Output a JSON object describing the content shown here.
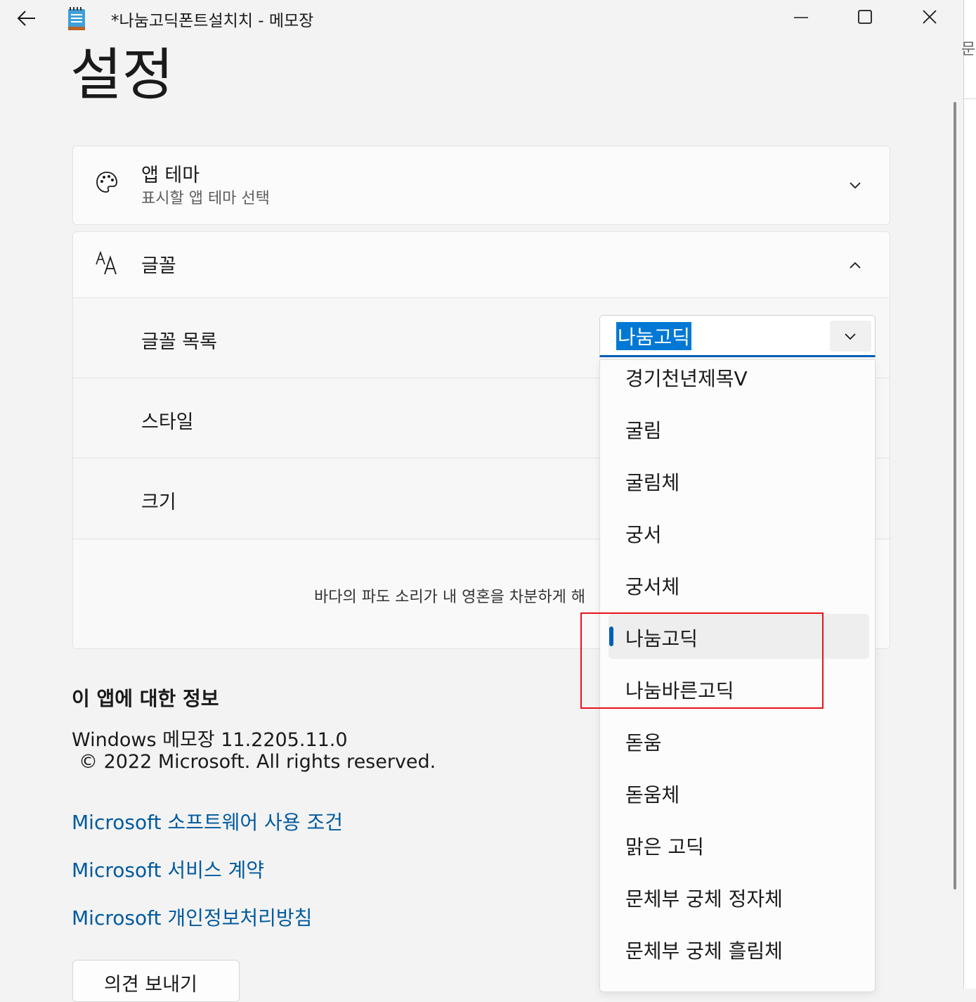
{
  "window": {
    "title": "*나눔고딕폰트설치치 - 메모장",
    "peek_text": "문",
    "icons": {
      "back": "arrow-left-icon",
      "app": "notepad-icon",
      "minimize": "minimize-icon",
      "maximize": "maximize-icon",
      "close": "close-icon"
    }
  },
  "page": {
    "title": "설정"
  },
  "theme_card": {
    "title": "앱 테마",
    "subtitle": "표시할 앱 테마 선택",
    "icon": "palette-icon",
    "chevron": "chevron-down-icon"
  },
  "font_card": {
    "title": "글꼴",
    "icon": "font-icon",
    "chevron": "chevron-up-icon",
    "font_list_label": "글꼴 목록",
    "style_label": "스타일",
    "size_label": "크기",
    "preview_text": "바다의 파도 소리가 내 영혼을 차분하게 해",
    "combo_value": "나눔고딕"
  },
  "dropdown": {
    "options": [
      "경기천년제목V",
      "굴림",
      "굴림체",
      "궁서",
      "궁서체",
      "나눔고딕",
      "나눔바른고딕",
      "돋움",
      "돋움체",
      "맑은 고딕",
      "문체부 궁체 정자체",
      "문체부 궁체 흘림체"
    ],
    "selected": "나눔고딕"
  },
  "about": {
    "heading": "이 앱에 대한 정보",
    "version": "Windows 메모장 11.2205.11.0",
    "copyright": "© 2022 Microsoft. All rights reserved.",
    "links": [
      "Microsoft 소프트웨어 사용 조건",
      "Microsoft 서비스 계약",
      "Microsoft 개인정보처리방침"
    ],
    "feedback_button": "의견 보내기"
  },
  "colors": {
    "accent": "#005fb8",
    "link": "#005a9e",
    "highlight": "#0078d4",
    "annotation_box": "#e8121b"
  }
}
